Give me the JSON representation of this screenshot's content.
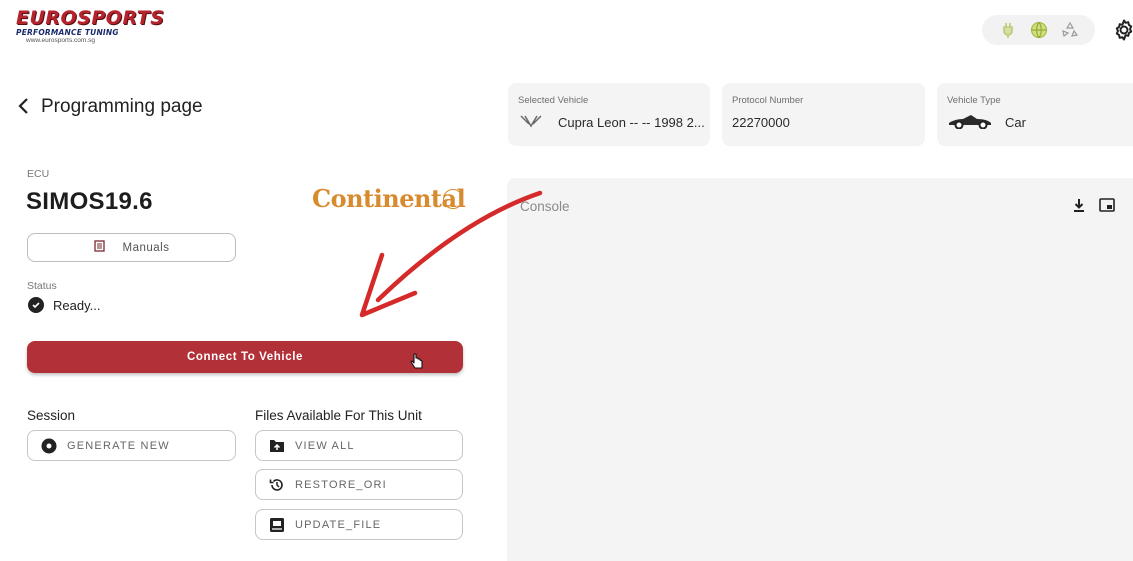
{
  "brand": {
    "name": "EUROSPORTS",
    "tagline": "PERFORMANCE TUNING",
    "url": "www.eurosports.com.sg"
  },
  "topbar": {
    "status_icons": [
      "usb-plug-icon",
      "globe-icon",
      "recycle-icon"
    ],
    "settings_icon": "gear-icon"
  },
  "header": {
    "title": "Programming page",
    "back_icon": "chevron-left-icon"
  },
  "cards": {
    "vehicle": {
      "label": "Selected Vehicle",
      "value": "Cupra Leon -- -- 1998 2...",
      "icon": "cupra-logo-icon"
    },
    "protocol": {
      "label": "Protocol Number",
      "value": "22270000"
    },
    "type": {
      "label": "Vehicle Type",
      "value": "Car",
      "icon": "car-icon"
    }
  },
  "ecu": {
    "label": "ECU",
    "name": "SIMOS19.6",
    "manufacturer_logo": "Continental"
  },
  "manuals": {
    "label": "Manuals",
    "icon": "book-icon"
  },
  "status": {
    "label": "Status",
    "value": "Ready...",
    "icon": "check-circle-icon"
  },
  "connect_button": {
    "label": "Connect To Vehicle"
  },
  "session": {
    "title": "Session",
    "generate_label": "GENERATE NEW"
  },
  "files": {
    "title": "Files Available For This Unit",
    "buttons": [
      {
        "label": "VIEW ALL",
        "icon": "folder-upload-icon"
      },
      {
        "label": "RESTORE_ORI",
        "icon": "history-icon"
      },
      {
        "label": "UPDATE_FILE",
        "icon": "file-update-icon"
      }
    ]
  },
  "console": {
    "title": "Console",
    "tools": [
      "download-icon",
      "picture-in-picture-icon"
    ]
  },
  "colors": {
    "accent": "#b23038",
    "brand_red": "#b5232d",
    "continental_orange": "#d88a2e",
    "annotation_red": "#d42a2a"
  }
}
